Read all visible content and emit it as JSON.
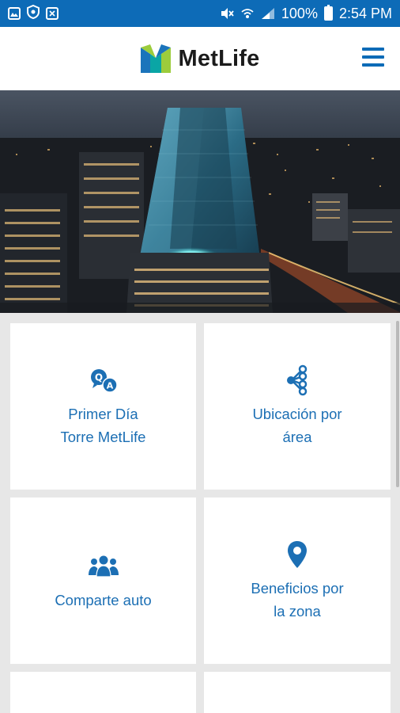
{
  "status_bar": {
    "left_icons": [
      "gallery-icon",
      "shield-icon",
      "document-icon"
    ],
    "right_icons": [
      "mute-icon",
      "wifi-icon",
      "signal-icon",
      "battery-icon"
    ],
    "battery": "100%",
    "time": "2:54 PM"
  },
  "header": {
    "brand": "MetLife",
    "menu_icon": "hamburger-menu-icon"
  },
  "hero": {
    "image": "night city skyline with glass tower"
  },
  "tiles": [
    {
      "label": "Primer Día\nTorre MetLife",
      "icon": "qa-icon"
    },
    {
      "label": "Ubicación por\nárea",
      "icon": "share-nodes-icon"
    },
    {
      "label": "Comparte auto",
      "icon": "group-users-icon"
    },
    {
      "label": "Beneficios por\nla zona",
      "icon": "map-pin-icon"
    },
    {
      "label": "",
      "icon": ""
    },
    {
      "label": "",
      "icon": ""
    }
  ],
  "colors": {
    "status_bar": "#0d6bb7",
    "accent": "#1c6fb4",
    "background": "#e7e7e7",
    "logo_green": "#9ccc3c",
    "logo_blue": "#1b74bb",
    "logo_teal": "#0aa5a5"
  }
}
